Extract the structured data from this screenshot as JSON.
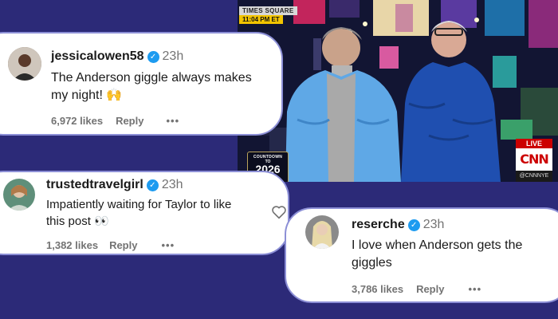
{
  "photo": {
    "location_tag": "TIMES SQUARE",
    "time_tag": "11:04 PM ET",
    "countdown_line1": "COUNTDOWN",
    "countdown_line2": "TO",
    "countdown_year": "2026",
    "live_label": "LIVE",
    "network_logo": "CNN",
    "network_handle": "@CNNNYE"
  },
  "comments": [
    {
      "username": "jessicalowen58",
      "time": "23h",
      "text_line1": "The Anderson giggle always makes",
      "text_line2": "my night! 🙌",
      "likes": "6,972 likes",
      "reply": "Reply",
      "more": "•••"
    },
    {
      "username": "trustedtravelgirl",
      "time": "23h",
      "text_line1": "Impatiently waiting for Taylor to like",
      "text_line2": "this post 👀",
      "likes": "1,382 likes",
      "reply": "Reply",
      "more": "•••"
    },
    {
      "username": "reserche",
      "time": "23h",
      "text_line1": "I love when Anderson gets the",
      "text_line2": "giggles",
      "likes": "3,786 likes",
      "reply": "Reply",
      "more": "•••"
    }
  ],
  "icons": {
    "verified": "verified-badge-icon",
    "heart": "heart-icon"
  },
  "colors": {
    "background": "#2c2a78",
    "card_border": "#8c8fd6",
    "verified": "#1d9bf0"
  }
}
